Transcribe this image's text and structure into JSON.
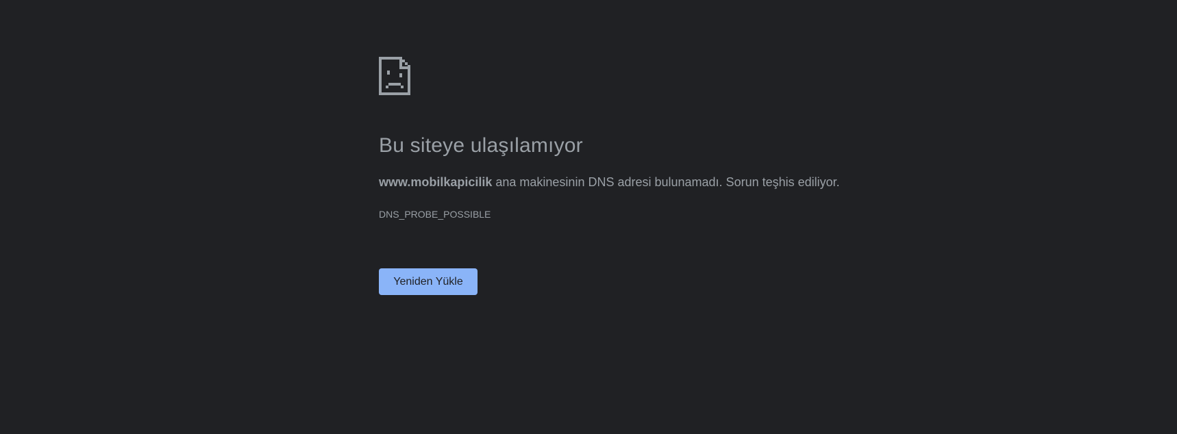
{
  "error_page": {
    "icon": "sad-page-icon",
    "title": "Bu siteye ulaşılamıyor",
    "summary": {
      "host": "www.mobilkapicilik",
      "message": " ana makinesinin DNS adresi bulunamadı. Sorun teşhis ediliyor."
    },
    "error_code": "DNS_PROBE_POSSIBLE",
    "reload_label": "Yeniden Yükle"
  },
  "colors": {
    "background": "#202124",
    "text": "#9aa0a6",
    "button": "#8ab4f8",
    "button_text": "#202124"
  }
}
